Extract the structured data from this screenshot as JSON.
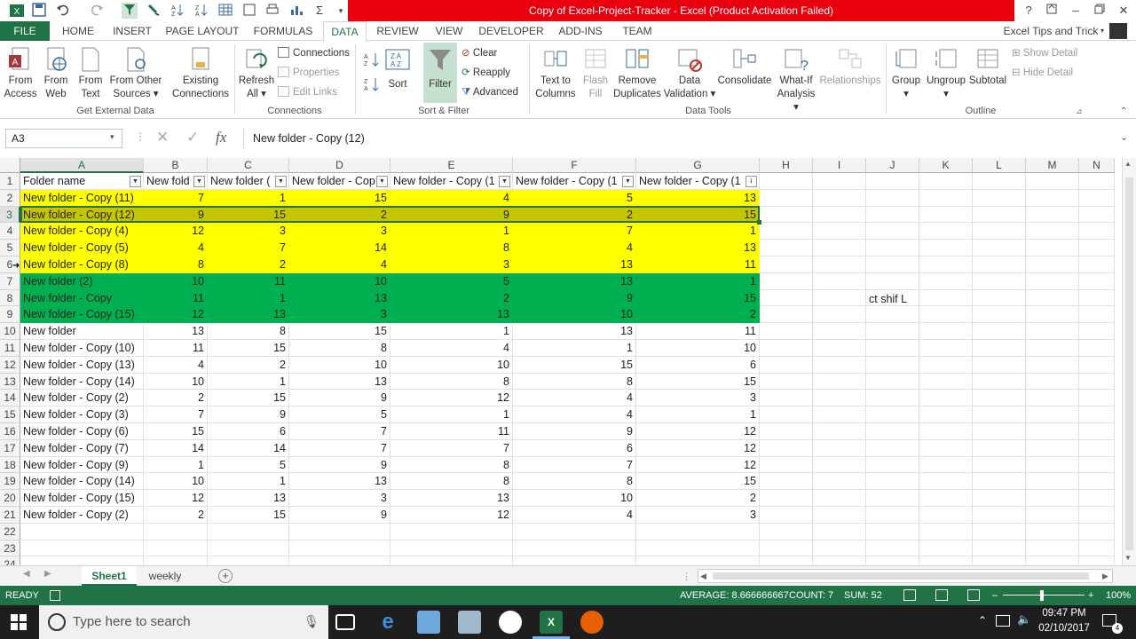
{
  "window": {
    "title": "Copy of Excel-Project-Tracker - Excel (Product Activation Failed)",
    "account": "Excel Tips and Trick"
  },
  "tabs": [
    {
      "label": "FILE"
    },
    {
      "label": "HOME"
    },
    {
      "label": "INSERT"
    },
    {
      "label": "PAGE LAYOUT"
    },
    {
      "label": "FORMULAS"
    },
    {
      "label": "DATA"
    },
    {
      "label": "REVIEW"
    },
    {
      "label": "VIEW"
    },
    {
      "label": "DEVELOPER"
    },
    {
      "label": "ADD-INS"
    },
    {
      "label": "TEAM"
    }
  ],
  "ribbon": {
    "get_external": {
      "group": "Get External Data",
      "access": [
        "From",
        "Access"
      ],
      "web": [
        "From",
        "Web"
      ],
      "text": [
        "From",
        "Text"
      ],
      "other": [
        "From Other",
        "Sources"
      ],
      "existing": [
        "Existing",
        "Connections"
      ]
    },
    "connections": {
      "group": "Connections",
      "refresh": [
        "Refresh",
        "All"
      ],
      "connections": "Connections",
      "properties": "Properties",
      "edit_links": "Edit Links"
    },
    "sort_filter": {
      "group": "Sort & Filter",
      "sort": "Sort",
      "filter": "Filter",
      "clear": "Clear",
      "reapply": "Reapply",
      "advanced": "Advanced"
    },
    "data_tools": {
      "group": "Data Tools",
      "text_to_columns": [
        "Text to",
        "Columns"
      ],
      "flash_fill": [
        "Flash",
        "Fill"
      ],
      "remove_duplicates": [
        "Remove",
        "Duplicates"
      ],
      "data_validation": [
        "Data",
        "Validation"
      ],
      "consolidate": "Consolidate",
      "what_if": [
        "What-If",
        "Analysis"
      ],
      "relationships": "Relationships"
    },
    "outline": {
      "group": "Outline",
      "group_btn": "Group",
      "ungroup": "Ungroup",
      "subtotal": "Subtotal",
      "show_detail": "Show Detail",
      "hide_detail": "Hide Detail"
    }
  },
  "formula_bar": {
    "name_box": "A3",
    "fx": "fx",
    "content": "New folder - Copy (12)"
  },
  "columns": [
    "A",
    "B",
    "C",
    "D",
    "E",
    "F",
    "G",
    "H",
    "I",
    "J",
    "K",
    "L",
    "M",
    "N"
  ],
  "header_row": [
    "Folder name",
    "New fold",
    "New folder (",
    "New folder - Cop",
    "New folder - Copy (1",
    "New folder - Copy (1",
    "New folder - Copy (1"
  ],
  "rows": [
    {
      "n": "2",
      "fill": "yellow",
      "cells": [
        "New folder - Copy (11)",
        "7",
        "1",
        "15",
        "4",
        "5",
        "13"
      ]
    },
    {
      "n": "3",
      "fill": "olive",
      "cells": [
        "New folder - Copy (12)",
        "9",
        "15",
        "2",
        "9",
        "2",
        "15"
      ]
    },
    {
      "n": "4",
      "fill": "yellow",
      "cells": [
        "New folder - Copy (4)",
        "12",
        "3",
        "3",
        "1",
        "7",
        "1"
      ]
    },
    {
      "n": "5",
      "fill": "yellow",
      "cells": [
        "New folder - Copy (5)",
        "4",
        "7",
        "14",
        "8",
        "4",
        "13"
      ]
    },
    {
      "n": "6",
      "fill": "yellow",
      "cells": [
        "New folder - Copy (8)",
        "8",
        "2",
        "4",
        "3",
        "13",
        "11"
      ]
    },
    {
      "n": "7",
      "fill": "green",
      "cells": [
        "New folder (2)",
        "10",
        "11",
        "10",
        "5",
        "13",
        "1"
      ]
    },
    {
      "n": "8",
      "fill": "green",
      "cells": [
        "New folder - Copy",
        "11",
        "1",
        "13",
        "2",
        "9",
        "15"
      ]
    },
    {
      "n": "9",
      "fill": "green",
      "cells": [
        "New folder - Copy (15)",
        "12",
        "13",
        "3",
        "13",
        "10",
        "2"
      ]
    },
    {
      "n": "10",
      "fill": "none",
      "cells": [
        "New folder",
        "13",
        "8",
        "15",
        "1",
        "13",
        "11"
      ]
    },
    {
      "n": "11",
      "fill": "none",
      "cells": [
        "New folder - Copy (10)",
        "11",
        "15",
        "8",
        "4",
        "1",
        "10"
      ]
    },
    {
      "n": "12",
      "fill": "none",
      "cells": [
        "New folder - Copy (13)",
        "4",
        "2",
        "10",
        "10",
        "15",
        "6"
      ]
    },
    {
      "n": "13",
      "fill": "none",
      "cells": [
        "New folder - Copy (14)",
        "10",
        "1",
        "13",
        "8",
        "8",
        "15"
      ]
    },
    {
      "n": "14",
      "fill": "none",
      "cells": [
        "New folder - Copy (2)",
        "2",
        "15",
        "9",
        "12",
        "4",
        "3"
      ]
    },
    {
      "n": "15",
      "fill": "none",
      "cells": [
        "New folder - Copy (3)",
        "7",
        "9",
        "5",
        "1",
        "4",
        "1"
      ]
    },
    {
      "n": "16",
      "fill": "none",
      "cells": [
        "New folder - Copy (6)",
        "15",
        "6",
        "7",
        "11",
        "9",
        "12"
      ]
    },
    {
      "n": "17",
      "fill": "none",
      "cells": [
        "New folder - Copy (7)",
        "14",
        "14",
        "7",
        "7",
        "6",
        "12"
      ]
    },
    {
      "n": "18",
      "fill": "none",
      "cells": [
        "New folder - Copy (9)",
        "1",
        "5",
        "9",
        "8",
        "7",
        "12"
      ]
    },
    {
      "n": "19",
      "fill": "none",
      "cells": [
        "New folder - Copy (14)",
        "10",
        "1",
        "13",
        "8",
        "8",
        "15"
      ]
    },
    {
      "n": "20",
      "fill": "none",
      "cells": [
        "New folder - Copy (15)",
        "12",
        "13",
        "3",
        "13",
        "10",
        "2"
      ]
    },
    {
      "n": "21",
      "fill": "none",
      "cells": [
        "New folder - Copy (2)",
        "2",
        "15",
        "9",
        "12",
        "4",
        "3"
      ]
    }
  ],
  "extra_rows": [
    "22",
    "23",
    "24"
  ],
  "note_cell": {
    "text": "ct shif L"
  },
  "fills": {
    "yellow": "#ffff00",
    "olive": "#c6c600",
    "green": "#00b050",
    "none": "#ffffff"
  },
  "sheets": [
    {
      "label": "Sheet1",
      "active": true
    },
    {
      "label": "weekly",
      "active": false
    }
  ],
  "status": {
    "mode": "READY",
    "average": "AVERAGE: 8.666666667",
    "count": "COUNT: 7",
    "sum": "SUM: 52",
    "zoom": "100%"
  },
  "taskbar": {
    "search_placeholder": "Type here to search",
    "time": "09:47 PM",
    "date": "02/10/2017",
    "notifications": "4"
  },
  "colors": {
    "excel_green": "#217346",
    "title_red": "#e8000f"
  }
}
